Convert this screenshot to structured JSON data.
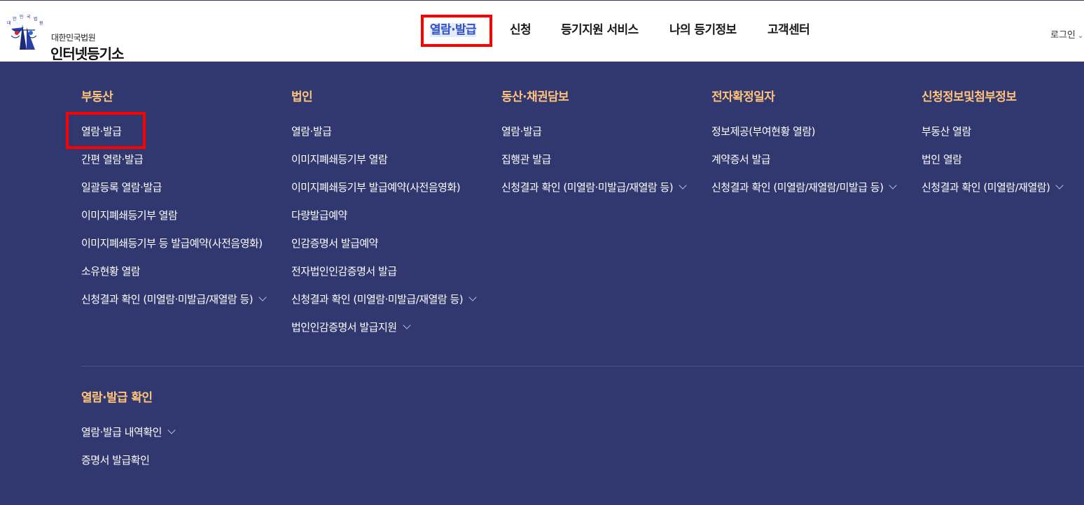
{
  "header": {
    "logo_small": "대한민국법원",
    "logo_big": "인터넷등기소",
    "nav": [
      {
        "label": "열람·발급",
        "active": true
      },
      {
        "label": "신청",
        "active": false
      },
      {
        "label": "등기지원 서비스",
        "active": false
      },
      {
        "label": "나의 등기정보",
        "active": false
      },
      {
        "label": "고객센터",
        "active": false
      }
    ],
    "login_label": "로그인"
  },
  "mega_menu": {
    "columns": [
      {
        "title": "부동산",
        "items": [
          {
            "label": "열람·발급",
            "highlighted": true
          },
          {
            "label": "간편 열람·발급"
          },
          {
            "label": "일괄등록 열람·발급"
          },
          {
            "label": "이미지폐쇄등기부 열람"
          },
          {
            "label": "이미지폐쇄등기부 등 발급예약(사전음영화)"
          },
          {
            "label": "소유현황 열람"
          },
          {
            "label": "신청결과 확인 (미열람·미발급/재열람 등)",
            "expandable": true
          }
        ]
      },
      {
        "title": "법인",
        "items": [
          {
            "label": "열람·발급"
          },
          {
            "label": "이미지폐쇄등기부 열람"
          },
          {
            "label": "이미지폐쇄등기부 발급예약(사전음영화)"
          },
          {
            "label": "다량발급예약"
          },
          {
            "label": "인감증명서 발급예약"
          },
          {
            "label": "전자법인인감증명서 발급"
          },
          {
            "label": "신청결과 확인 (미열람·미발급/재열람 등)",
            "expandable": true
          },
          {
            "label": "법인인감증명서 발급지원",
            "expandable": true
          }
        ]
      },
      {
        "title": "동산·채권담보",
        "items": [
          {
            "label": "열람·발급"
          },
          {
            "label": "집행관 발급"
          },
          {
            "label": "신청결과 확인 (미열람·미발급/재열람 등)",
            "expandable": true
          }
        ]
      },
      {
        "title": "전자확정일자",
        "items": [
          {
            "label": "정보제공(부여현황 열람)"
          },
          {
            "label": "계약증서 발급"
          },
          {
            "label": "신청결과 확인 (미열람/재열람/미발급 등)",
            "expandable": true
          }
        ]
      },
      {
        "title": "신청정보및첨부정보",
        "items": [
          {
            "label": "부동산 열람"
          },
          {
            "label": "법인 열람"
          },
          {
            "label": "신청결과 확인 (미열람/재열람)",
            "expandable": true
          }
        ]
      }
    ],
    "bottom_section": {
      "title": "열람·발급 확인",
      "items": [
        {
          "label": "열람·발급 내역확인",
          "expandable": true
        },
        {
          "label": "증명서 발급확인"
        }
      ]
    }
  },
  "colors": {
    "panel_bg": "#31376f",
    "section_title": "#ffc47a",
    "active_nav": "#2f51c9",
    "highlight": "#ff0000"
  }
}
